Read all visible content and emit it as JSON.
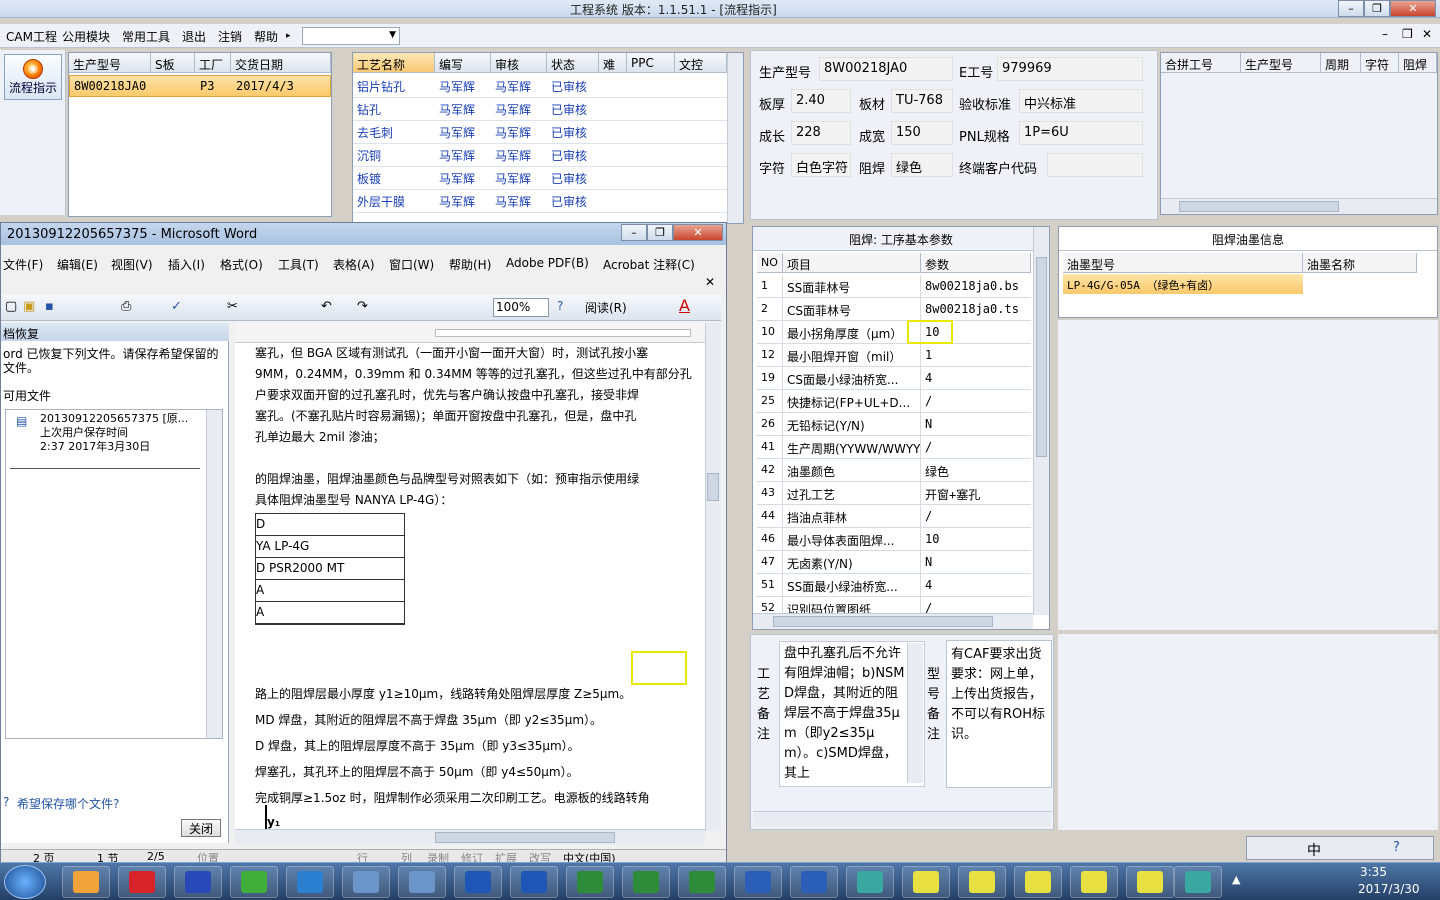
{
  "app": {
    "title": "工程系统    版本：1.1.51.1 - [流程指示]",
    "menu": [
      "CAM工程",
      "公用模块",
      "常用工具",
      "退出",
      "注销",
      "帮助"
    ],
    "flow_button": "流程指示"
  },
  "order_grid": {
    "headers": [
      "生产型号",
      "S板",
      "工厂",
      "交货日期"
    ],
    "rows": [
      [
        "8W00218JA0",
        "",
        "P3",
        "2017/4/3"
      ]
    ]
  },
  "process_grid": {
    "headers": [
      "工艺名称",
      "编写",
      "审核",
      "状态",
      "难",
      "PPC",
      "文控"
    ],
    "rows": [
      [
        "铝片钻孔",
        "马军辉",
        "马军辉",
        "已审核"
      ],
      [
        "钻孔",
        "马军辉",
        "马军辉",
        "已审核"
      ],
      [
        "去毛刺",
        "马军辉",
        "马军辉",
        "已审核"
      ],
      [
        "沉铜",
        "马军辉",
        "马军辉",
        "已审核"
      ],
      [
        "板镀",
        "马军辉",
        "马军辉",
        "已审核"
      ],
      [
        "外层干膜",
        "马军辉",
        "马军辉",
        "已审核"
      ]
    ]
  },
  "info": {
    "model_label": "生产型号",
    "model": "8W00218JA0",
    "eno_label": "E工号",
    "eno": "979969",
    "thickness_label": "板厚",
    "thickness": "2.40",
    "material_label": "板材",
    "material": "TU-768",
    "std_label": "验收标准",
    "std": "中兴标准",
    "len_label": "成长",
    "len": "228",
    "wid_label": "成宽",
    "wid": "150",
    "pnl_label": "PNL规格",
    "pnl": "1P=6U",
    "char_label": "字符",
    "char": "白色字符",
    "solder_label": "阻焊",
    "solder": "绿色",
    "customer_label": "终端客户代码",
    "customer": ""
  },
  "merge_grid": {
    "headers": [
      "合拼工号",
      "生产型号",
      "周期",
      "字符",
      "阻焊"
    ]
  },
  "params": {
    "title": "阻焊: 工序基本参数",
    "headers": [
      "NO",
      "项目",
      "参数"
    ],
    "rows": [
      [
        "1",
        "SS面菲林号",
        "8w00218ja0.bs"
      ],
      [
        "2",
        "CS面菲林号",
        "8w00218ja0.ts"
      ],
      [
        "10",
        "最小拐角厚度（μm）",
        "10"
      ],
      [
        "12",
        "最小阻焊开窗（mil）",
        "1"
      ],
      [
        "19",
        "CS面最小绿油桥宽...",
        "4"
      ],
      [
        "25",
        "快捷标记(FP+UL+D...",
        "/"
      ],
      [
        "26",
        "无铅标记(Y/N)",
        "N"
      ],
      [
        "41",
        "生产周期(YYWW/WWYY)",
        "/"
      ],
      [
        "42",
        "油墨颜色",
        "绿色"
      ],
      [
        "43",
        "过孔工艺",
        "开窗+塞孔"
      ],
      [
        "44",
        "挡油点菲林",
        "/"
      ],
      [
        "46",
        "最小导体表面阻焊...",
        "10"
      ],
      [
        "47",
        "无卤素(Y/N)",
        "N"
      ],
      [
        "51",
        "SS面最小绿油桥宽...",
        "4"
      ],
      [
        "52",
        "识别码位置图纸",
        "/"
      ]
    ]
  },
  "ink": {
    "title": "阻焊油墨信息",
    "headers": [
      "油墨型号",
      "油墨名称"
    ],
    "rows": [
      [
        "LP-4G/G-05A （绿色+有卤）",
        ""
      ]
    ]
  },
  "remarks": {
    "label1": "工艺备注",
    "text1": "盘中孔塞孔后不允许有阻焊油帽；b)NSMD焊盘，其附近的阻焊层不高于焊盘35μm（即y2≤35μm）。c)SMD焊盘，其上",
    "label2": "型号备注",
    "text2": "有CAF要求出货要求：网上单，上传出货报告，不可以有ROH标识。"
  },
  "word": {
    "title": "20130912205657375 - Microsoft Word",
    "menu": [
      "文件(F)",
      "编辑(E)",
      "视图(V)",
      "插入(I)",
      "格式(O)",
      "工具(T)",
      "表格(A)",
      "窗口(W)",
      "帮助(H)",
      "Adobe PDF(B)",
      "Acrobat 注释(C)"
    ],
    "zoom": "100%",
    "read_button": "阅读(R)",
    "recovery_title": "档恢复",
    "recovery_text": "ord 已恢复下列文件。请保存希望保留的文件。",
    "recovery_avail": "可用文件",
    "recovery_file": "20130912205657375 [原...",
    "recovery_file_sub1": "上次用户保存时间",
    "recovery_file_sub2": "2:37 2017年3月30日",
    "recovery_question": "希望保存哪个文件?",
    "close_button": "关闭",
    "doc_lines": [
      "塞孔，但 BGA 区域有测试孔（一面开小窗一面开大窗）时，测试孔按小塞",
      "9MM，0.24MM，0.39mm 和 0.34MM 等等的过孔塞孔，但这些过孔中有部分孔",
      "户要求双面开窗的过孔塞孔时，优先与客户确认按盘中孔塞孔，接受非焊",
      "塞孔。(不塞孔贴片时容易漏锡)；单面开窗按盘中孔塞孔，但是，盘中孔",
      "孔单边最大 2mil 渗油；",
      "",
      "的阻焊油墨，阻焊油墨颜色与品牌型号对照表如下（如：预审指示使用绿",
      "具体阻焊油墨型号 NANYA  LP-4G）："
    ],
    "doc_table": [
      "D",
      "YA   LP-4G",
      "D      PSR2000  MT",
      "A",
      "A"
    ],
    "doc_lines2": [
      "路上的阻焊层最小厚度 y1≥10μm，线路转角处阻焊层厚度 Z≥5μm。",
      "MD 焊盘，其附近的阻焊层不高于焊盘 35μm（即 y2≤35μm）。",
      "D 焊盘，其上的阻焊层厚度不高于 35μm（即 y3≤35μm）。",
      "焊塞孔，其孔环上的阻焊层不高于 50μm（即 y4≤50μm）。",
      "完成铜厚≥1.5oz 时，阻焊制作必须采用二次印刷工艺。电源板的线路转角"
    ],
    "y1_label": "y₁",
    "status": [
      "2 页",
      "1 节",
      "2/5",
      "位置",
      "行",
      "列",
      "录制",
      "修订",
      "扩展",
      "改写",
      "中文(中国)"
    ]
  },
  "taskbar": {
    "time": "3:35",
    "date": "2017/3/30",
    "ime": "中"
  }
}
